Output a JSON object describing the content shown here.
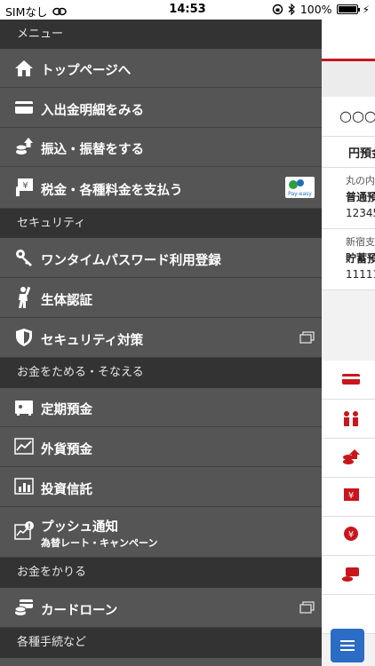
{
  "status_bar": {
    "carrier": "SIMなし",
    "time": "14:53",
    "battery_text": "100%",
    "battery_level": 1.0
  },
  "drawer": {
    "sections": [
      {
        "title": "メニュー",
        "items": [
          {
            "label": "トップページへ",
            "icon": "home-icon"
          },
          {
            "label": "入出金明細をみる",
            "icon": "card-icon"
          },
          {
            "label": "振込・振替をする",
            "icon": "coins-transfer-icon"
          },
          {
            "label": "税金・各種料金を支払う",
            "icon": "payment-icon",
            "badge": "Pay-easy"
          }
        ]
      },
      {
        "title": "セキュリティ",
        "items": [
          {
            "label": "ワンタイムパスワード利用登録",
            "icon": "key-icon"
          },
          {
            "label": "生体認証",
            "icon": "person-icon"
          },
          {
            "label": "セキュリティ対策",
            "icon": "shield-icon",
            "external": true
          }
        ]
      },
      {
        "title": "お金をためる・そなえる",
        "items": [
          {
            "label": "定期預金",
            "icon": "safe-icon"
          },
          {
            "label": "外貨預金",
            "icon": "chart-line-icon"
          },
          {
            "label": "投資信託",
            "icon": "bar-chart-icon"
          },
          {
            "label": "プッシュ通知",
            "sublabel": "為替レート・キャンペーン",
            "icon": "notification-chart-icon"
          }
        ]
      },
      {
        "title": "お金をかりる",
        "items": [
          {
            "label": "カードローン",
            "icon": "card-loan-icon",
            "external": true
          }
        ]
      },
      {
        "title": "各種手続など",
        "items": []
      }
    ]
  },
  "background": {
    "title": "○○○",
    "subtitle": "円預金",
    "accounts": [
      {
        "branch": "丸の内",
        "type": "普通預",
        "number": "12345"
      },
      {
        "branch": "新宿支",
        "type": "貯蓄預",
        "number": "11111"
      }
    ],
    "menu_button_icon": "menu-icon"
  },
  "colors": {
    "drawer_bg": "#555555",
    "section_bg": "#333333",
    "accent_red": "#c8161d",
    "menu_button": "#2b6cc4"
  }
}
